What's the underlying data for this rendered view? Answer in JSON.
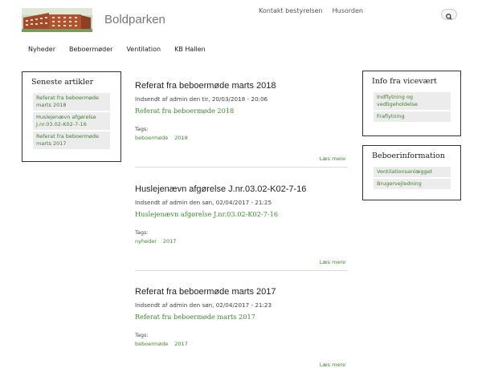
{
  "site": {
    "name": "Boldparken"
  },
  "toplinks": [
    "Kontakt bestyrelsen",
    "Husorden"
  ],
  "nav": [
    "Nyheder",
    "Beboermøder",
    "Ventilation",
    "KB Hallen"
  ],
  "left_box": {
    "title": "Seneste artikler",
    "items": [
      "Referat fra beboermøde marts 2018",
      "Huslejenævn afgørelse J.nr.03.02-K02-7-16",
      "Referat fra beboermøde marts 2017"
    ]
  },
  "info_box": {
    "title": "Info fra vicevært",
    "items": [
      "Indflytning og vedligeholdelse",
      "Fraflytning"
    ]
  },
  "resident_box": {
    "title": "Beboerinformation",
    "items": [
      "Ventilationsanlægget",
      "Brugervejledning"
    ]
  },
  "articles": [
    {
      "title": "Referat fra beboermøde marts 2018",
      "meta": "Indsendt af admin den tir, 20/03/2018 - 20:06",
      "link": "Referat fra beboermøde 2018",
      "tags_label": "Tags:",
      "tags": [
        "beboermøde",
        "2018"
      ],
      "more": "Læs mere"
    },
    {
      "title": "Huslejenævn afgørelse J.nr.03.02-K02-7-16",
      "meta": "Indsendt af admin den søn, 02/04/2017 - 21:25",
      "link": "Huslejenævn afgørelse J.nr.03.02-K02-7-16",
      "tags_label": "Tags:",
      "tags": [
        "nyheder",
        "2017"
      ],
      "more": "Læs mere"
    },
    {
      "title": "Referat fra beboermøde marts 2017",
      "meta": "Indsendt af admin den søn, 02/04/2017 - 21:23",
      "link": "Referat fra beboermøde marts 2017",
      "tags_label": "Tags:",
      "tags": [
        "beboermøde",
        "2017"
      ],
      "more": "Læs mere"
    }
  ],
  "icons": {
    "search": "search-icon",
    "logo": "building-logo"
  }
}
